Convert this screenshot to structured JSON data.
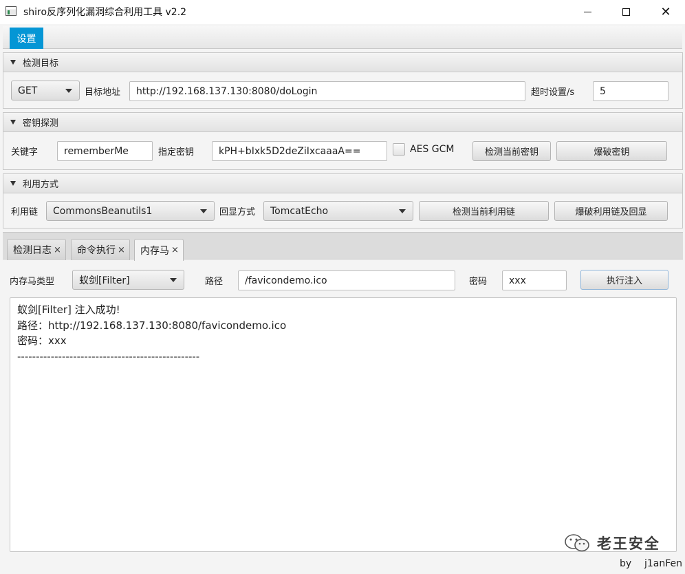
{
  "window": {
    "title": "shiro反序列化漏洞综合利用工具 v2.2",
    "minimize_glyph": "",
    "close_glyph": "✕"
  },
  "menu": {
    "settings_label": "设置"
  },
  "target_panel": {
    "header": "检测目标",
    "method_value": "GET",
    "url_label": "目标地址",
    "url_value": "http://192.168.137.130:8080/doLogin",
    "timeout_label": "超时设置/s",
    "timeout_value": "5"
  },
  "key_panel": {
    "header": "密钥探测",
    "keyword_label": "关键字",
    "keyword_value": "rememberMe",
    "key_label": "指定密钥",
    "key_value": "kPH+bIxk5D2deZiIxcaaaA==",
    "aes_gcm_label": "AES GCM",
    "aes_gcm_checked": false,
    "detect_key_button": "检测当前密钥",
    "brute_key_button": "爆破密钥"
  },
  "exploit_panel": {
    "header": "利用方式",
    "chain_label": "利用链",
    "chain_value": "CommonsBeanutils1",
    "echo_label": "回显方式",
    "echo_value": "TomcatEcho",
    "detect_chain_button": "检测当前利用链",
    "brute_chain_button": "爆破利用链及回显"
  },
  "tabs": [
    {
      "label": "检测日志",
      "active": false
    },
    {
      "label": "命令执行",
      "active": false
    },
    {
      "label": "内存马",
      "active": true
    }
  ],
  "tab_close_glyph": "×",
  "memshell": {
    "type_label": "内存马类型",
    "type_value": "蚁剑[Filter]",
    "path_label": "路径",
    "path_value": "/favicondemo.ico",
    "password_label": "密码",
    "password_value": "xxx",
    "inject_button": "执行注入"
  },
  "output_lines": [
    "蚁剑[Filter]  注入成功!",
    "路径：http://192.168.137.130:8080/favicondemo.ico",
    "密码：xxx",
    "-------------------------------------------------"
  ],
  "watermark_text": "老王安全",
  "footer": {
    "by": "by",
    "author": "j1anFen"
  }
}
